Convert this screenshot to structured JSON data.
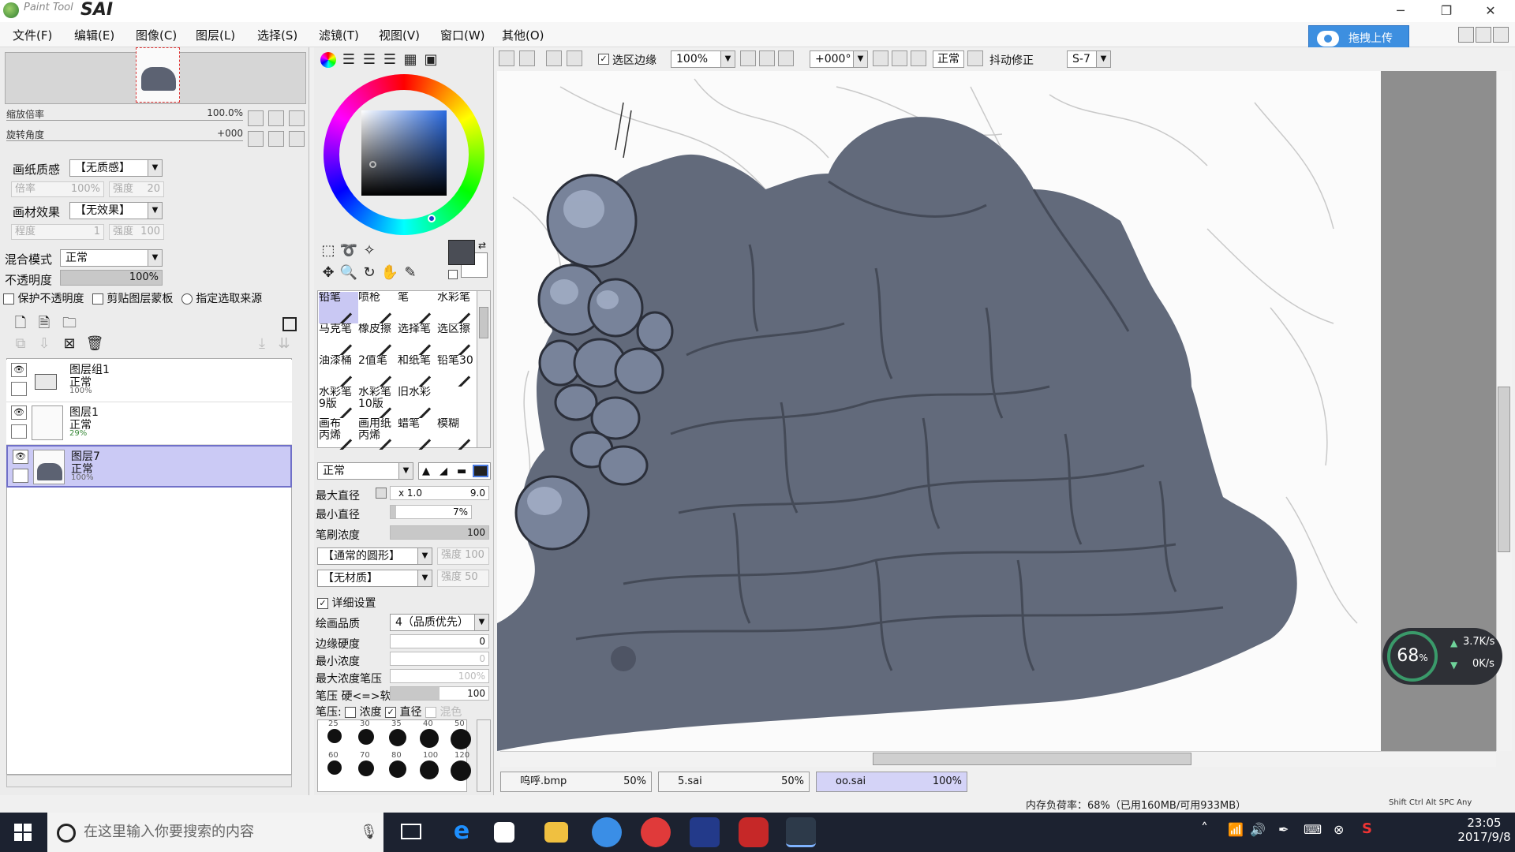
{
  "app": {
    "logo_text": "Paint Tool",
    "logo_sai": "SAI"
  },
  "menu": [
    "文件(F)",
    "编辑(E)",
    "图像(C)",
    "图层(L)",
    "选择(S)",
    "滤镜(T)",
    "视图(V)",
    "窗口(W)",
    "其他(O)"
  ],
  "upload_button": "拖拽上传",
  "navigator": {
    "zoom_label": "缩放倍率",
    "zoom_value": "100.0%",
    "rotate_label": "旋转角度",
    "rotate_value": "+000"
  },
  "paper": {
    "texture_label": "画纸质感",
    "texture_value": "【无质感】",
    "scale_label": "倍率",
    "scale_value": "100%",
    "strength_label": "强度",
    "strength_value": "20",
    "effect_label": "画材效果",
    "effect_value": "【无效果】",
    "degree_label": "程度",
    "degree_value": "1",
    "strength2_label": "强度",
    "strength2_value": "100"
  },
  "blend": {
    "label": "混合模式",
    "value": "正常",
    "opacity_label": "不透明度",
    "opacity_value": "100%",
    "opacity_level": 1.0
  },
  "options": {
    "protect_opacity": "保护不透明度",
    "clip_mask": "剪贴图层蒙板",
    "selection_source": "指定选取来源"
  },
  "layers": [
    {
      "name": "图层组1",
      "mode": "正常",
      "opacity": "100%",
      "type": "folder",
      "selected": false
    },
    {
      "name": "图层1",
      "mode": "正常",
      "opacity": "29%",
      "type": "layer",
      "selected": false
    },
    {
      "name": "图层7",
      "mode": "正常",
      "opacity": "100%",
      "type": "layer",
      "selected": true
    }
  ],
  "colors": {
    "foreground": "#4a4d55",
    "background": "#ffffff",
    "selection": "#cbcaf5",
    "accent": "#3d8fe0"
  },
  "brushes": [
    [
      "铅笔",
      "喷枪",
      "笔",
      "水彩笔"
    ],
    [
      "马克笔",
      "橡皮擦",
      "选择笔",
      "选区擦"
    ],
    [
      "油漆桶",
      "2值笔",
      "和纸笔",
      "铅笔30"
    ],
    [
      "水彩笔\n9版",
      "水彩笔\n10版",
      "旧水彩",
      ""
    ],
    [
      "画布\n丙烯",
      "画用纸\n丙烯",
      "蜡笔",
      "模糊"
    ]
  ],
  "brush_settings": {
    "mode": "正常",
    "max_diameter_label": "最大直径",
    "max_diameter_mult": "x 1.0",
    "max_diameter_value": "9.0",
    "min_diameter_label": "最小直径",
    "min_diameter_value": "7%",
    "density_label": "笔刷浓度",
    "density_value": "100",
    "shape": "【通常的圆形】",
    "shape_strength": "强度 100",
    "texture": "【无材质】",
    "texture_strength": "强度 50",
    "detail_label": "详细设置",
    "quality_label": "绘画品质",
    "quality_value": "4（品质优先）",
    "edge_label": "边缘硬度",
    "edge_value": "0",
    "min_density_label": "最小浓度",
    "min_density_value": "0",
    "max_pressure_label": "最大浓度笔压",
    "max_pressure_value": "100%",
    "pressure_label": "笔压 硬<=>软",
    "pressure_value": "100",
    "pen_pressure_label": "笔压:",
    "pen_density": "浓度",
    "pen_diameter": "直径",
    "pen_mix": "混色"
  },
  "brush_sizes": [
    [
      "25",
      "30",
      "35",
      "40",
      "50"
    ],
    [
      "60",
      "70",
      "80",
      "100",
      "120"
    ]
  ],
  "canvas_toolbar": {
    "selection_edge": "选区边缘",
    "zoom": "100%",
    "angle": "+000°",
    "mode": "正常",
    "stabilizer_label": "抖动修正",
    "stabilizer_value": "S-7"
  },
  "documents": [
    {
      "name": "呜呼.bmp",
      "zoom": "50%",
      "active": false
    },
    {
      "name": "5.sai",
      "zoom": "50%",
      "active": false
    },
    {
      "name": "oo.sai",
      "zoom": "100%",
      "active": true
    }
  ],
  "status": {
    "memory": "内存负荷率：68%（已用160MB/可用933MB）",
    "keys": "Shift Ctrl Alt SPC Any"
  },
  "perf": {
    "percent": "68",
    "unit": "%",
    "up": "3.7K/s",
    "down": "0K/s"
  },
  "taskbar": {
    "search_placeholder": "在这里输入你要搜索的内容",
    "time": "23:05",
    "date": "2017/9/8"
  }
}
